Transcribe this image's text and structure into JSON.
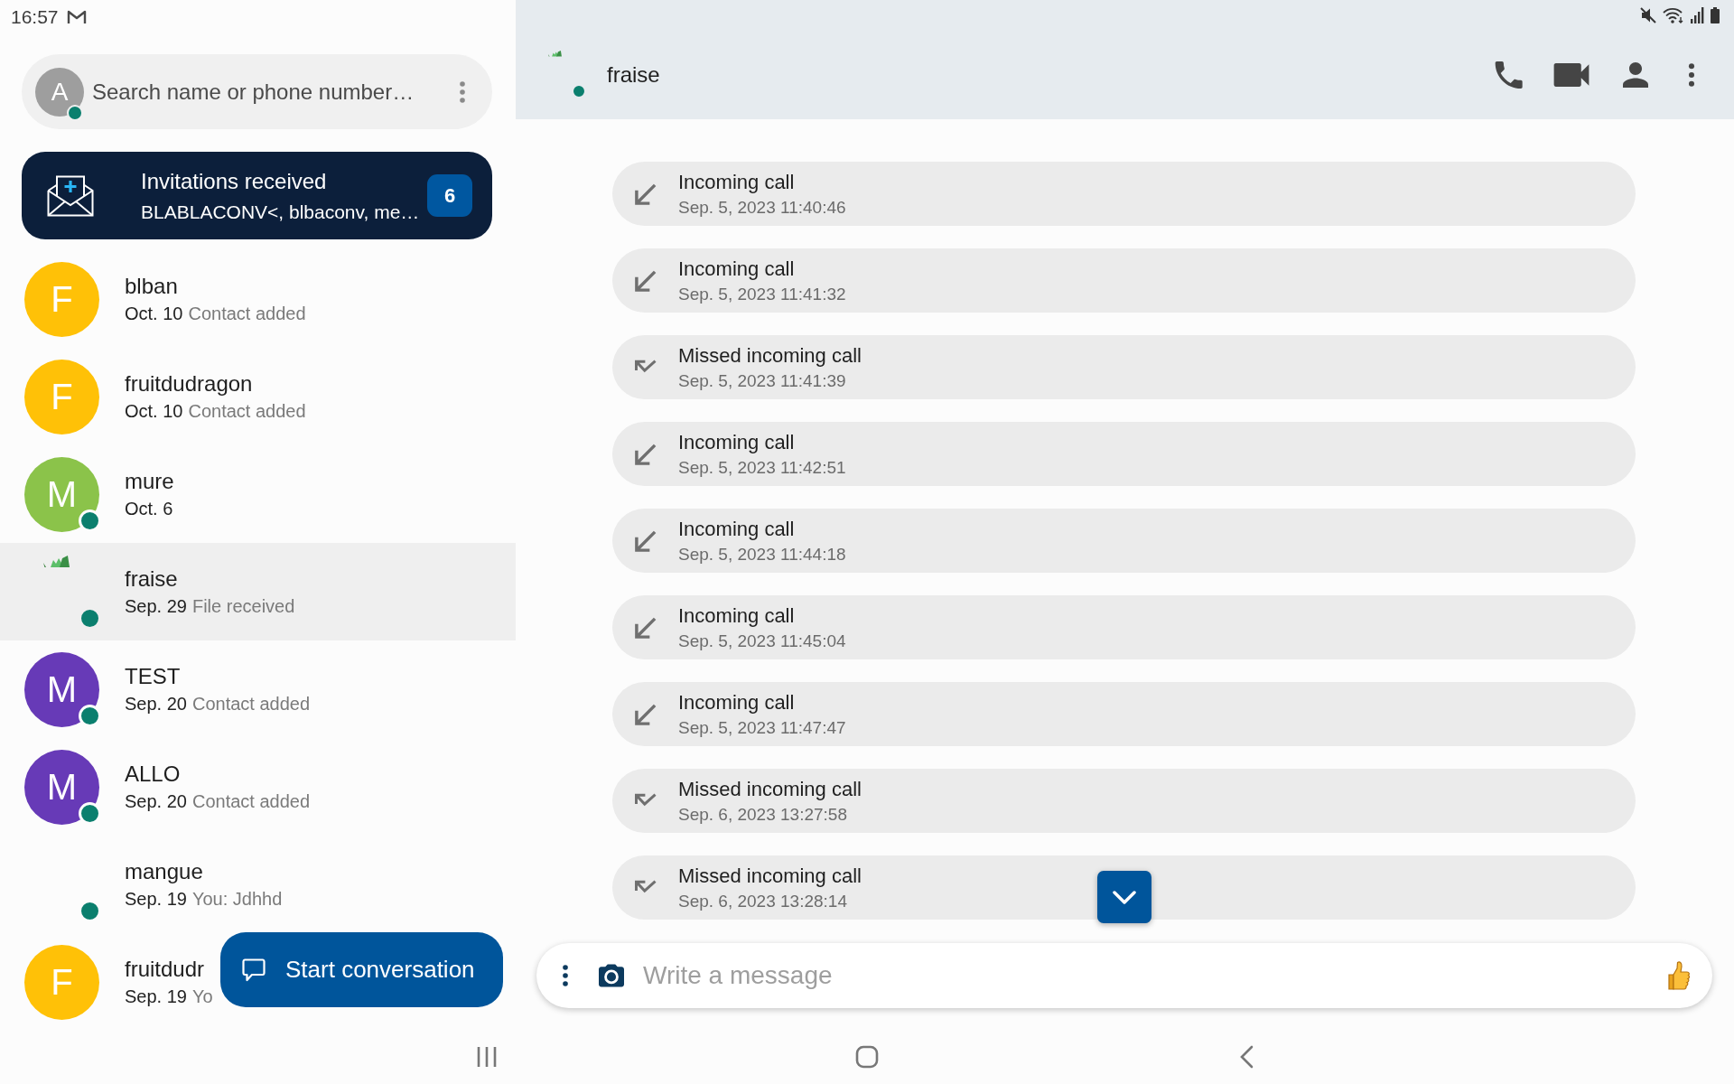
{
  "status_bar": {
    "time": "16:57"
  },
  "search": {
    "avatar_letter": "A",
    "online": true,
    "placeholder": "Search name or phone number…"
  },
  "invitations": {
    "title": "Invitations received",
    "subtitle": "BLABLACONV<, blbaconv, me…",
    "count": "6"
  },
  "conversations": [
    {
      "name": "blban",
      "date": "Oct. 10",
      "preview": "Contact added",
      "avatar": {
        "kind": "letter",
        "letter": "F",
        "color": "#ffc107"
      },
      "online": false,
      "selected": false
    },
    {
      "name": "fruitdudragon",
      "date": "Oct. 10",
      "preview": "Contact added",
      "avatar": {
        "kind": "letter",
        "letter": "F",
        "color": "#ffc107"
      },
      "online": false,
      "selected": false
    },
    {
      "name": "mure",
      "date": "Oct. 6",
      "avatar": {
        "kind": "letter",
        "letter": "M",
        "color": "#8bc34a"
      },
      "online": true,
      "selected": false
    },
    {
      "name": "fraise",
      "date": "Sep. 29",
      "preview": "File received",
      "avatar": {
        "kind": "image"
      },
      "online": true,
      "selected": true
    },
    {
      "name": "TEST",
      "date": "Sep. 20",
      "preview": "Contact added",
      "avatar": {
        "kind": "letter",
        "letter": "M",
        "color": "#673ab7"
      },
      "online": true,
      "selected": false
    },
    {
      "name": "ALLO",
      "date": "Sep. 20",
      "preview": "Contact added",
      "avatar": {
        "kind": "letter",
        "letter": "M",
        "color": "#673ab7"
      },
      "online": true,
      "selected": false
    },
    {
      "name": "mangue",
      "date": "Sep. 19",
      "preview": "You: Jdhhd",
      "online": true,
      "selected": false
    },
    {
      "name": "fruitdudr",
      "date": "Sep. 19",
      "preview": "Yo",
      "avatar": {
        "kind": "letter",
        "letter": "F",
        "color": "#ffc107"
      },
      "online": false,
      "selected": false
    }
  ],
  "start_button": {
    "label": "Start conversation"
  },
  "chat": {
    "header": {
      "name": "fraise",
      "avatar": {
        "kind": "image"
      },
      "online": true
    },
    "calls": [
      {
        "kind": "incoming",
        "title": "Incoming call",
        "time": "Sep. 5, 2023 11:40:46"
      },
      {
        "kind": "incoming",
        "title": "Incoming call",
        "time": "Sep. 5, 2023 11:41:32"
      },
      {
        "kind": "missed",
        "title": "Missed incoming call",
        "time": "Sep. 5, 2023 11:41:39"
      },
      {
        "kind": "incoming",
        "title": "Incoming call",
        "time": "Sep. 5, 2023 11:42:51"
      },
      {
        "kind": "incoming",
        "title": "Incoming call",
        "time": "Sep. 5, 2023 11:44:18"
      },
      {
        "kind": "incoming",
        "title": "Incoming call",
        "time": "Sep. 5, 2023 11:45:04"
      },
      {
        "kind": "incoming",
        "title": "Incoming call",
        "time": "Sep. 5, 2023 11:47:47"
      },
      {
        "kind": "missed",
        "title": "Missed incoming call",
        "time": "Sep. 6, 2023 13:27:58"
      },
      {
        "kind": "missed",
        "title": "Missed incoming call",
        "time": "Sep. 6, 2023 13:28:14"
      }
    ],
    "composer": {
      "placeholder": "Write a message"
    }
  }
}
